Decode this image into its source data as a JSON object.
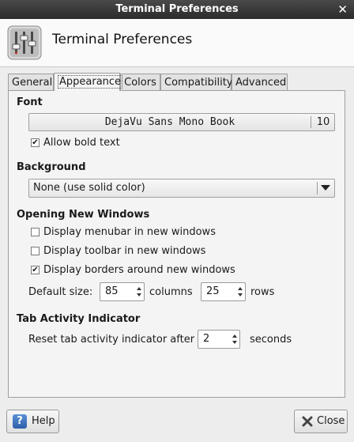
{
  "window": {
    "title": "Terminal Preferences",
    "close_glyph": "✕",
    "close_icon": "close-icon"
  },
  "header": {
    "title": "Terminal Preferences",
    "icon": "mixer-sliders-icon"
  },
  "tabs": [
    {
      "label": "General",
      "active": false
    },
    {
      "label": "Appearance",
      "active": true
    },
    {
      "label": "Colors",
      "active": false
    },
    {
      "label": "Compatibility",
      "active": false
    },
    {
      "label": "Advanced",
      "active": false
    }
  ],
  "font": {
    "section_title": "Font",
    "name": "DejaVu Sans Mono Book",
    "size": "10",
    "allow_bold": {
      "label": "Allow bold text",
      "checked": true
    }
  },
  "background": {
    "section_title": "Background",
    "selected": "None (use solid color)"
  },
  "opening": {
    "section_title": "Opening New Windows",
    "options": [
      {
        "label": "Display menubar in new windows",
        "checked": false
      },
      {
        "label": "Display toolbar in new windows",
        "checked": false
      },
      {
        "label": "Display borders around new windows",
        "checked": true
      }
    ],
    "default_size_label": "Default size:",
    "columns_value": "85",
    "columns_label": "columns",
    "rows_value": "25",
    "rows_label": "rows"
  },
  "tab_activity": {
    "section_title": "Tab Activity Indicator",
    "reset_label": "Reset tab activity indicator after",
    "reset_value": "2",
    "seconds_label": "seconds"
  },
  "buttons": {
    "help_label": "Help",
    "help_glyph": "?",
    "close_label": "Close"
  },
  "colors": {
    "titlebar": "#2b2b2b",
    "help_icon": "#2d5fa8",
    "close_icon": "#444444"
  }
}
